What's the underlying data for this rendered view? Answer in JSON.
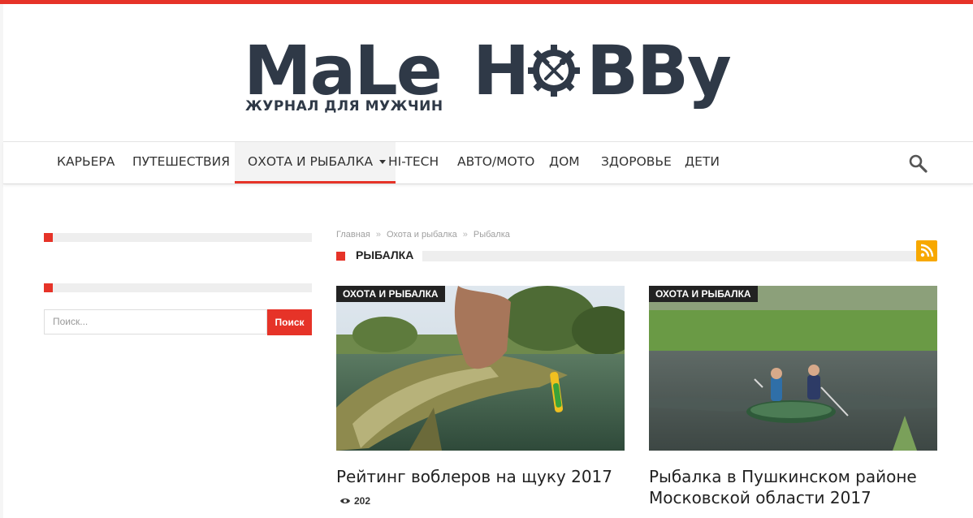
{
  "site": {
    "logo_word1": "MaLe",
    "logo_word2_a": "H",
    "logo_word2_b": "BBy",
    "tagline": "ЖУРНАЛ ДЛЯ МУЖЧИН",
    "accent_color": "#e63328",
    "logo_color": "#2f3947"
  },
  "nav": {
    "items": [
      {
        "label": "КАРЬЕРА"
      },
      {
        "label": "ПУТЕШЕСТВИЯ"
      },
      {
        "label": "ОХОТА И РЫБАЛКА"
      },
      {
        "label": "HI-TECH"
      },
      {
        "label": "АВТО/МОТО"
      },
      {
        "label": "ДОМ"
      },
      {
        "label": "ЗДОРОВЬЕ"
      },
      {
        "label": "ДЕТИ"
      }
    ],
    "active_item": "ОХОТА И РЫБАЛКА",
    "search_icon": "search-icon"
  },
  "sidebar": {
    "search_placeholder": "Поиск...",
    "search_button": "Поиск"
  },
  "breadcrumb": [
    "Главная",
    "Охота и рыбалка",
    "Рыбалка"
  ],
  "section": {
    "title": "РЫБАЛКА",
    "rss_icon": "rss-icon"
  },
  "articles": [
    {
      "category": "ОХОТА И РЫБАЛКА",
      "title": "Рейтинг воблеров на щуку 2017",
      "views": "202"
    },
    {
      "category": "ОХОТА И РЫБАЛКА",
      "title_line1": "Рыбалка в Пушкинском районе",
      "title_line2": "Московской области 2017"
    }
  ]
}
